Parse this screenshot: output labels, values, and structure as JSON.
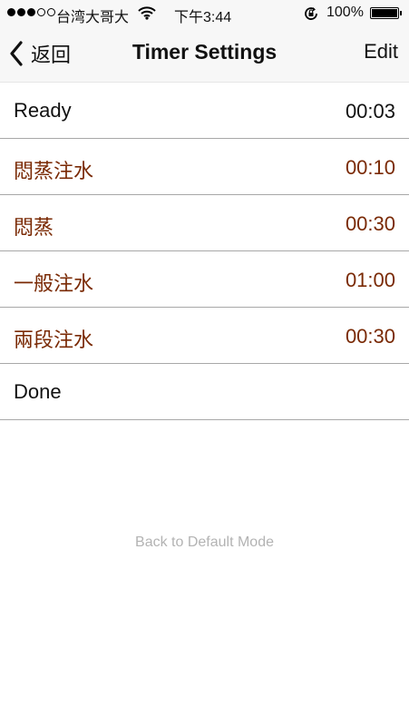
{
  "status_bar": {
    "carrier": "台湾大哥大",
    "time": "下午3:44",
    "battery": "100%",
    "signal_bars_filled": 3,
    "signal_bars_total": 5
  },
  "nav": {
    "back_label": "返回",
    "title": "Timer Settings",
    "edit_label": "Edit"
  },
  "timers": [
    {
      "name": "Ready",
      "duration": "00:03"
    },
    {
      "name": "悶蒸注水",
      "duration": "00:10"
    },
    {
      "name": "悶蒸",
      "duration": "00:30"
    },
    {
      "name": "一般注水",
      "duration": "01:00"
    },
    {
      "name": "兩段注水",
      "duration": "00:30"
    },
    {
      "name": "Done",
      "duration": ""
    }
  ],
  "footer": {
    "default_mode_label": "Back to Default Mode"
  },
  "colors": {
    "accent_brown": "#7a2a05",
    "text_dark": "#111111",
    "footer_gray": "#b3b3b3",
    "bar_background": "#f7f7f7"
  },
  "icons": {
    "wifi": "wifi-icon",
    "rotation_lock": "rotation-lock-icon",
    "battery": "battery-icon",
    "back": "chevron-left-icon"
  }
}
